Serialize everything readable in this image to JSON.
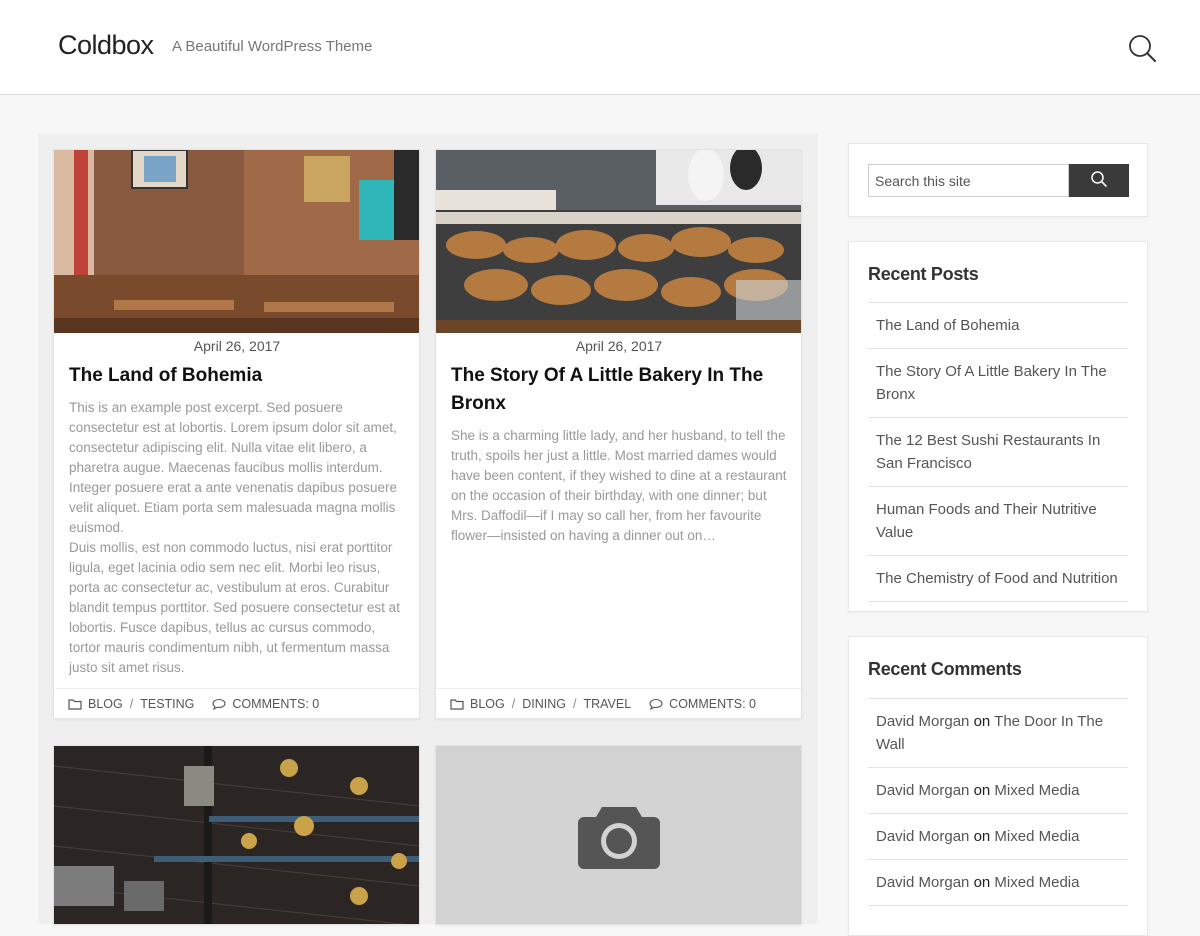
{
  "header": {
    "site_title": "Coldbox",
    "tagline": "A Beautiful WordPress Theme",
    "search_icon": "search-icon"
  },
  "posts": [
    {
      "date": "April 26, 2017",
      "title": "The Land of Bohemia",
      "excerpt_p1": "This is an example post excerpt. Sed posuere consectetur est at lobortis. Lorem ipsum dolor sit amet, consectetur adipiscing elit. Nulla vitae elit libero, a pharetra augue. Maecenas faucibus mollis interdum. Integer posuere erat a ante venenatis dapibus posuere velit aliquet. Etiam porta sem malesuada magna mollis euismod.",
      "excerpt_p2": "Duis mollis, est non commodo luctus, nisi erat porttitor ligula, eget lacinia odio sem nec elit. Morbi leo risus, porta ac consectetur ac, vestibulum at eros. Curabitur blandit tempus porttitor. Sed posuere consectetur est at lobortis. Fusce dapibus, tellus ac cursus commodo, tortor mauris condimentum nibh, ut fermentum massa justo sit amet risus.",
      "categories": [
        "BLOG",
        "TESTING"
      ],
      "comments": "COMMENTS: 0"
    },
    {
      "date": "April 26, 2017",
      "title": "The Story Of A Little Bakery In The Bronx",
      "excerpt_p1": "She is a charming little lady, and her husband, to tell the truth, spoils her just a little. Most married dames would have been content, if they wished to dine at a restaurant on the occasion of their birthday, with one dinner; but Mrs. Daffodil—if I may so call her, from her favourite flower—insisted on having a dinner out on…",
      "categories": [
        "BLOG",
        "DINING",
        "TRAVEL"
      ],
      "comments": "COMMENTS: 0"
    }
  ],
  "sidebar": {
    "search_placeholder": "Search this site",
    "recent_posts_title": "Recent Posts",
    "recent_posts": [
      "The Land of Bohemia",
      "The Story Of A Little Bakery In The Bronx",
      "The 12 Best Sushi Restaurants In San Francisco",
      "Human Foods and Their Nutritive Value",
      "The Chemistry of Food and Nutrition"
    ],
    "recent_comments_title": "Recent Comments",
    "recent_comments": [
      {
        "author": "David Morgan",
        "on": "on",
        "post": "The Door In The Wall"
      },
      {
        "author": "David Morgan",
        "on": "on",
        "post": "Mixed Media"
      },
      {
        "author": "David Morgan",
        "on": "on",
        "post": "Mixed Media"
      },
      {
        "author": "David Morgan",
        "on": "on",
        "post": "Mixed Media"
      }
    ]
  }
}
